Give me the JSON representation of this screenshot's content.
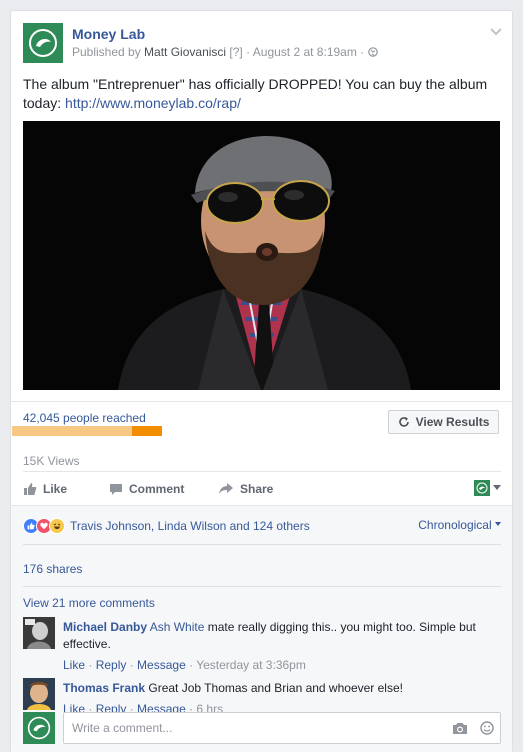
{
  "post": {
    "page_name": "Money Lab",
    "published_by": "Published by ",
    "publisher": "Matt Giovanisci",
    "help_marker": "[?]",
    "date": " · August 2 at 8:19am ·",
    "text": "The album \"Entreprenuer\" has officially DROPPED! You can buy the album today: ",
    "link": "http://www.moneylab.co/rap/"
  },
  "insights": {
    "reached": "42,045 people reached",
    "reach_progress": 0.8,
    "view_results": "View Results",
    "views": "15K Views"
  },
  "actions": {
    "like": "Like",
    "comment": "Comment",
    "share": "Share"
  },
  "reactions": {
    "people": "Travis Johnson, Linda Wilson and 124 others",
    "order": "Chronological",
    "shares": "176 shares",
    "more_comments": "View 21 more comments"
  },
  "comments": [
    {
      "author": "Michael Danby",
      "tag": "Ash White",
      "text": " mate really digging this.. you might too. Simple but effective.",
      "like": "Like",
      "reply": "Reply",
      "message": "Message",
      "time": "Yesterday at 3:36pm"
    },
    {
      "author": "Thomas Frank",
      "tag": "",
      "text": "Great Job Thomas and Brian and whoever else!",
      "like": "Like",
      "reply": "Reply",
      "message": "Message",
      "time": "6 hrs"
    }
  ],
  "composer": {
    "placeholder": "Write a comment..."
  },
  "colors": {
    "link": "#365899",
    "brand_green": "#2e8b57",
    "reach_orange": "#f39c12"
  }
}
